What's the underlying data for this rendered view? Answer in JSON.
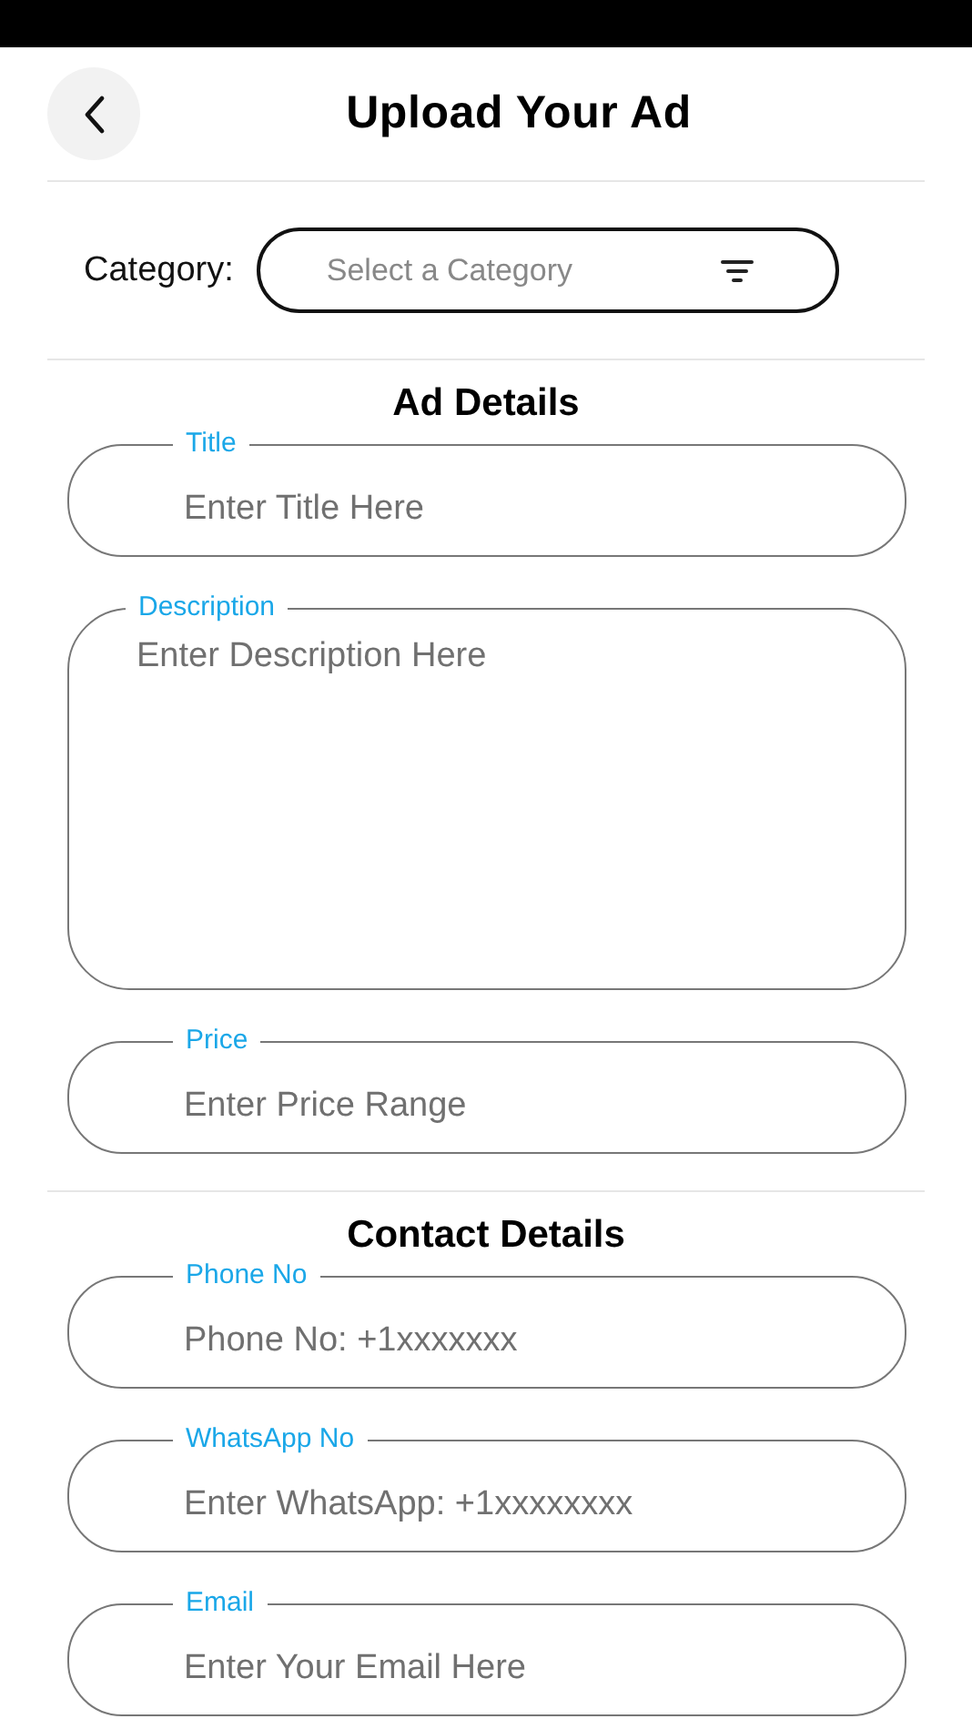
{
  "header": {
    "title": "Upload Your Ad"
  },
  "category": {
    "label": "Category:",
    "placeholder": "Select a Category"
  },
  "sections": [
    {
      "heading": "Ad Details",
      "fields": [
        {
          "kind": "line",
          "label": "Title",
          "placeholder": "Enter Title Here"
        },
        {
          "kind": "multiline",
          "label": "Description",
          "placeholder": "Enter Description Here"
        },
        {
          "kind": "line",
          "label": "Price",
          "placeholder": "Enter Price Range"
        }
      ]
    },
    {
      "heading": "Contact Details",
      "fields": [
        {
          "kind": "line",
          "label": "Phone No",
          "placeholder": "Phone No: +1xxxxxxx"
        },
        {
          "kind": "line",
          "label": "WhatsApp No",
          "placeholder": "Enter WhatsApp: +1xxxxxxxx"
        },
        {
          "kind": "line",
          "label": "Email",
          "placeholder": "Enter Your Email Here"
        }
      ]
    }
  ]
}
